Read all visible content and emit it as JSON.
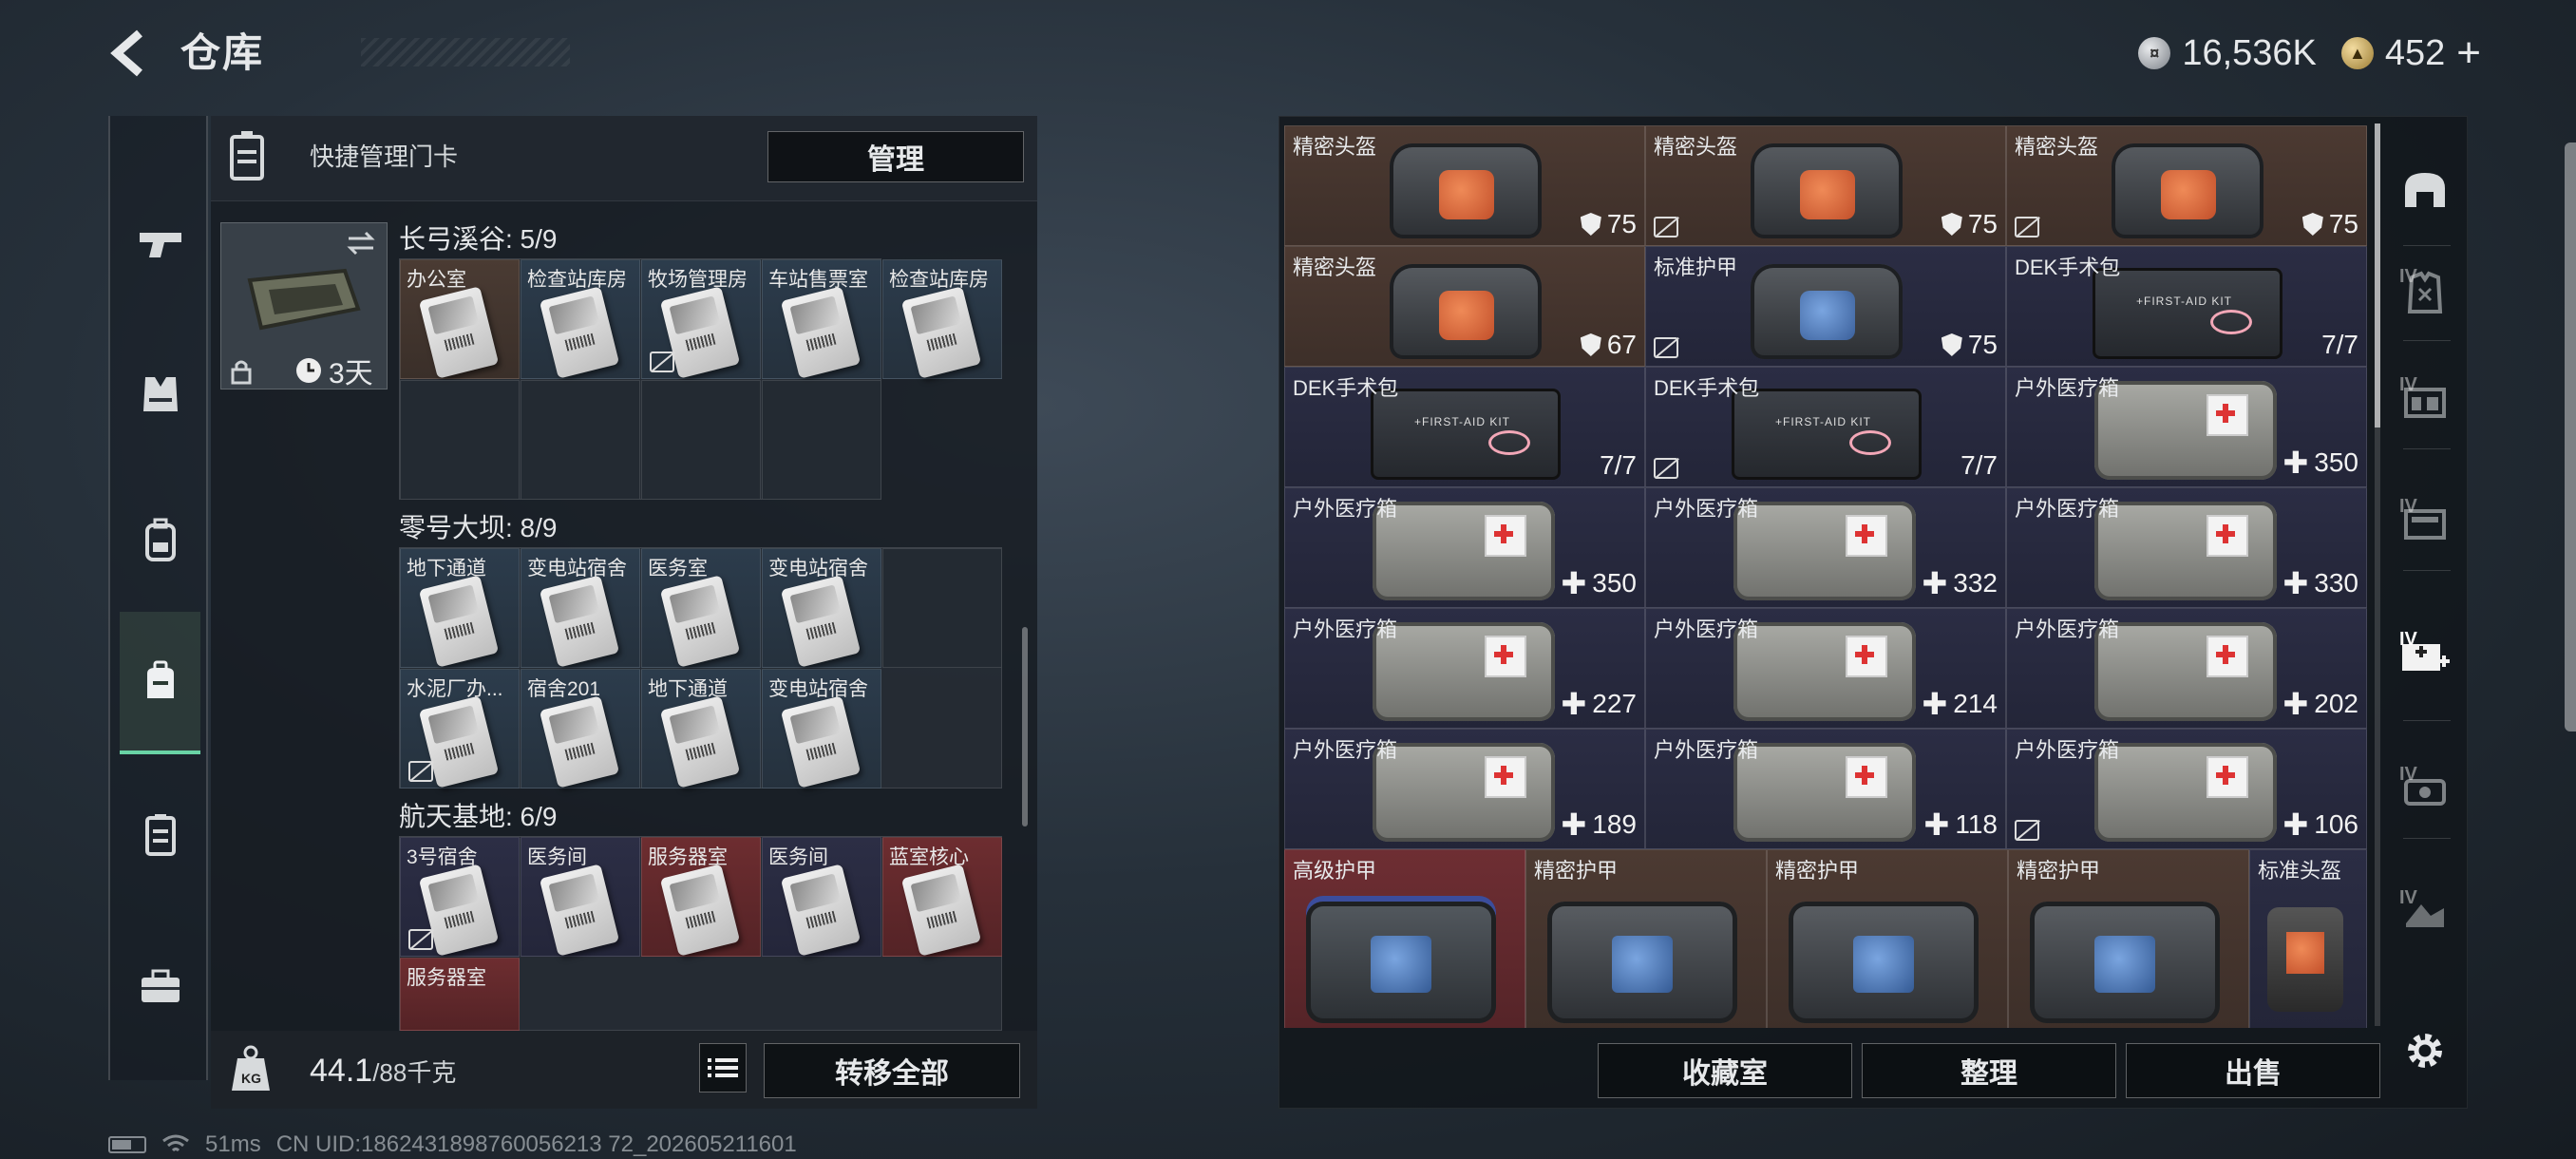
{
  "header": {
    "title": "仓库"
  },
  "currency": {
    "silver": "16,536K",
    "gold": "452",
    "add": "+"
  },
  "quick_bar": {
    "label": "快捷管理门卡",
    "manage": "管理"
  },
  "key_holder": {
    "duration": "3天"
  },
  "sections": [
    {
      "title": "长弓溪谷: 5/9",
      "slots": [
        "办公室",
        "检查站库房",
        "牧场管理房",
        "车站售票室",
        "检查站库房"
      ]
    },
    {
      "title": "零号大坝: 8/9",
      "slots": [
        "地下通道",
        "变电站宿舍",
        "医务室",
        "变电站宿舍",
        "水泥厂办...",
        "宿舍201",
        "地下通道",
        "变电站宿舍"
      ]
    },
    {
      "title": "航天基地: 6/9",
      "slots": [
        "3号宿舍",
        "医务间",
        "服务器室",
        "医务间",
        "蓝室核心",
        "服务器室"
      ]
    }
  ],
  "weight": {
    "current": "44.1",
    "max": "/88千克"
  },
  "buttons": {
    "transfer_all": "转移全部",
    "collection": "收藏室",
    "organize": "整理",
    "sell": "出售"
  },
  "items": [
    {
      "name": "精密头盔",
      "value": "75"
    },
    {
      "name": "精密头盔",
      "value": "75"
    },
    {
      "name": "精密头盔",
      "value": "75"
    },
    {
      "name": "精密头盔",
      "value": "67"
    },
    {
      "name": "标准护甲",
      "value": "75"
    },
    {
      "name": "DEK手术包",
      "value": "7/7"
    },
    {
      "name": "DEK手术包",
      "value": "7/7"
    },
    {
      "name": "DEK手术包",
      "value": "7/7"
    },
    {
      "name": "户外医疗箱",
      "value": "350"
    },
    {
      "name": "户外医疗箱",
      "value": "350"
    },
    {
      "name": "户外医疗箱",
      "value": "332"
    },
    {
      "name": "户外医疗箱",
      "value": "330"
    },
    {
      "name": "户外医疗箱",
      "value": "227"
    },
    {
      "name": "户外医疗箱",
      "value": "214"
    },
    {
      "name": "户外医疗箱",
      "value": "202"
    },
    {
      "name": "户外医疗箱",
      "value": "189"
    },
    {
      "name": "户外医疗箱",
      "value": "118"
    },
    {
      "name": "户外医疗箱",
      "value": "106"
    },
    {
      "name": "高级护甲"
    },
    {
      "name": "精密护甲"
    },
    {
      "name": "精密护甲"
    },
    {
      "name": "精密护甲"
    },
    {
      "name": "标准头盔"
    }
  ],
  "right_tabs": [
    {
      "tier": "IV"
    },
    {
      "tier": "IV"
    },
    {
      "tier": "IV"
    },
    {
      "tier": "IV"
    },
    {
      "tier": "IV"
    },
    {
      "tier": "IV"
    }
  ],
  "status": {
    "ping": "51ms",
    "uid": "CN UID:1862431898760056213 72_202605211601"
  }
}
